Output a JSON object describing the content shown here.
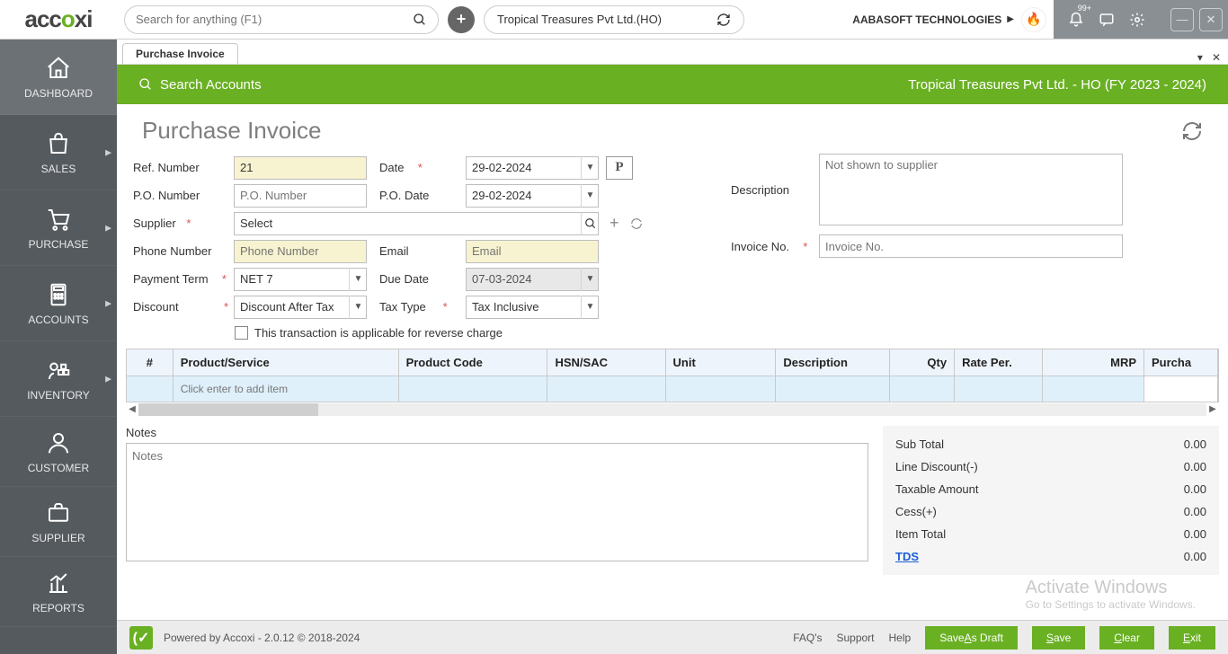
{
  "header": {
    "logo": "accoxi",
    "search_placeholder": "Search for anything (F1)",
    "company": "Tropical Treasures Pvt Ltd.(HO)",
    "tech": "AABASOFT TECHNOLOGIES",
    "notif_badge": "99+"
  },
  "sidebar": [
    {
      "key": "dashboard",
      "label": "DASHBOARD",
      "arrow": false
    },
    {
      "key": "sales",
      "label": "SALES",
      "arrow": true
    },
    {
      "key": "purchase",
      "label": "PURCHASE",
      "arrow": true
    },
    {
      "key": "accounts",
      "label": "ACCOUNTS",
      "arrow": true
    },
    {
      "key": "inventory",
      "label": "INVENTORY",
      "arrow": true
    },
    {
      "key": "customer",
      "label": "CUSTOMER"
    },
    {
      "key": "supplier",
      "label": "SUPPLIER"
    },
    {
      "key": "reports",
      "label": "REPORTS"
    }
  ],
  "tab": "Purchase Invoice",
  "greenbar": {
    "search": "Search Accounts",
    "context": "Tropical Treasures Pvt Ltd. - HO (FY 2023 - 2024)"
  },
  "page_title": "Purchase Invoice",
  "form": {
    "ref_number_label": "Ref. Number",
    "ref_number_value": "21",
    "date_label": "Date",
    "date_value": "29-02-2024",
    "po_number_label": "P.O. Number",
    "po_number_placeholder": "P.O. Number",
    "po_date_label": "P.O. Date",
    "po_date_value": "29-02-2024",
    "supplier_label": "Supplier",
    "supplier_value": "Select",
    "phone_label": "Phone Number",
    "phone_placeholder": "Phone Number",
    "email_label": "Email",
    "email_placeholder": "Email",
    "payment_term_label": "Payment Term",
    "payment_term_value": "NET 7",
    "due_date_label": "Due Date",
    "due_date_value": "07-03-2024",
    "discount_label": "Discount",
    "discount_value": "Discount After Tax",
    "tax_type_label": "Tax Type",
    "tax_type_value": "Tax Inclusive",
    "description_label": "Description",
    "description_placeholder": "Not shown to supplier",
    "invoice_no_label": "Invoice No.",
    "invoice_no_placeholder": "Invoice No.",
    "reverse_charge": "This transaction is applicable for reverse charge"
  },
  "table": {
    "headers": [
      "#",
      "Product/Service",
      "Product Code",
      "HSN/SAC",
      "Unit",
      "Description",
      "Qty",
      "Rate Per.",
      "MRP",
      "Purcha"
    ],
    "empty_hint": "Click enter to add item"
  },
  "notes_label": "Notes",
  "notes_placeholder": "Notes",
  "totals": [
    {
      "label": "Sub Total",
      "value": "0.00"
    },
    {
      "label": "Line Discount(-)",
      "value": "0.00"
    },
    {
      "label": "Taxable Amount",
      "value": "0.00"
    },
    {
      "label": "Cess(+)",
      "value": "0.00"
    },
    {
      "label": "Item Total",
      "value": "0.00"
    },
    {
      "label": "TDS",
      "value": "0.00",
      "link": true
    }
  ],
  "watermark": {
    "l1": "Activate Windows",
    "l2": "Go to Settings to activate Windows."
  },
  "footer": {
    "powered": "Powered by Accoxi - 2.0.12 © 2018-2024",
    "links": [
      "FAQ's",
      "Support",
      "Help"
    ],
    "buttons": {
      "draft": "Save As Draft",
      "save": "Save",
      "clear": "Clear",
      "exit": "Exit"
    }
  }
}
